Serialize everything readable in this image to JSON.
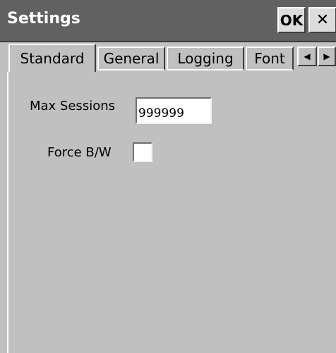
{
  "window": {
    "title": "Settings",
    "ok_label": "OK",
    "close_label": "✕"
  },
  "tabs": [
    {
      "label": "Standard",
      "active": true
    },
    {
      "label": "General",
      "active": false
    },
    {
      "label": "Logging",
      "active": false
    },
    {
      "label": "Font",
      "active": false
    }
  ],
  "tab_scroll": {
    "left_icon": "◀",
    "right_icon": "▶"
  },
  "standard_page": {
    "max_sessions_label": "Max Sessions",
    "max_sessions_value": "999999",
    "force_bw_label": "Force B/W",
    "force_bw_checked": false
  },
  "colors": {
    "titlebar": "#616161",
    "background": "#c0c0c0",
    "title_text": "#ffffff"
  }
}
